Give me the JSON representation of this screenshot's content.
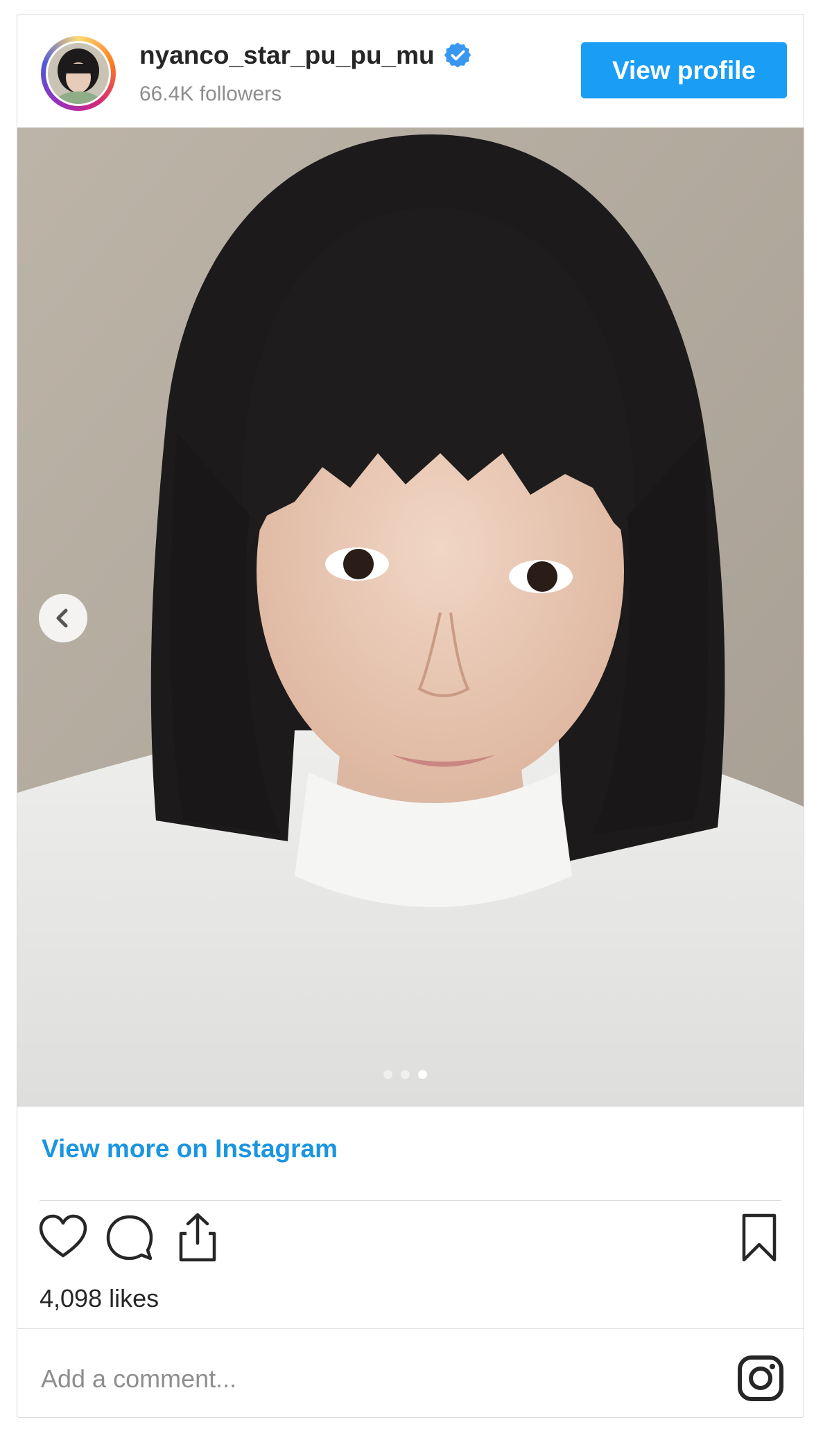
{
  "header": {
    "username": "nyanco_star_pu_pu_mu",
    "followers": "66.4K followers",
    "view_profile_label": "View profile",
    "verified_icon": "verified-badge-icon",
    "avatar_icon": "avatar"
  },
  "media": {
    "carousel_total": 3,
    "carousel_active": 3,
    "prev_icon": "chevron-left-icon"
  },
  "footer": {
    "view_more_label": "View more on Instagram",
    "likes_text": "4,098 likes",
    "comment_placeholder": "Add a comment...",
    "icons": [
      "heart-icon",
      "comment-icon",
      "share-icon",
      "bookmark-icon",
      "instagram-logo-icon"
    ]
  },
  "colors": {
    "accent": "#1a9df5",
    "link": "#1b95e0",
    "text": "#262626",
    "muted": "#8e8e8e",
    "border": "#dbdbdb"
  }
}
